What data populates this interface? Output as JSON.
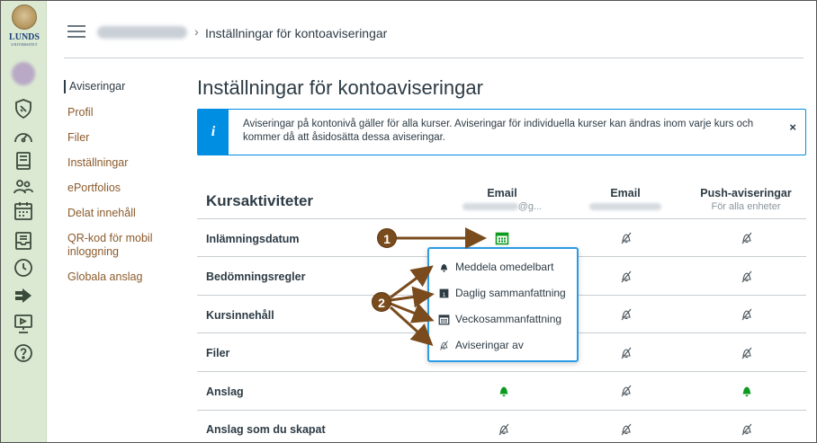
{
  "logo": {
    "name": "LUNDS",
    "subname": "UNIVERSITET"
  },
  "breadcrumb": {
    "separator": "›",
    "current": "Inställningar för kontoaviseringar"
  },
  "course_nav": {
    "items": [
      {
        "label": "Aviseringar",
        "active": true
      },
      {
        "label": "Profil",
        "active": false
      },
      {
        "label": "Filer",
        "active": false
      },
      {
        "label": "Inställningar",
        "active": false
      },
      {
        "label": "ePortfolios",
        "active": false
      },
      {
        "label": "Delat innehåll",
        "active": false
      },
      {
        "label": "QR-kod för mobil inloggning",
        "active": false
      },
      {
        "label": "Globala anslag",
        "active": false
      }
    ]
  },
  "page": {
    "title": "Inställningar för kontoaviseringar",
    "alert": {
      "icon": "info-icon",
      "icon_glyph": "i",
      "text": "Aviseringar på kontonivå gäller för alla kurser. Aviseringar för individuella kurser kan ändras inom varje kurs och kommer då att åsidosätta dessa aviseringar.",
      "close": "×"
    }
  },
  "table": {
    "heading": "Kursaktiviteter",
    "columns": [
      {
        "title": "Email",
        "subtitle_suffix": "@g..."
      },
      {
        "title": "Email",
        "subtitle_suffix": ""
      },
      {
        "title": "Push-aviseringar",
        "subtitle": "För alla enheter"
      }
    ],
    "rows": [
      {
        "label": "Inlämningsdatum",
        "cells": [
          "weekly-calendar-icon",
          "bell-off-icon",
          "bell-off-icon"
        ]
      },
      {
        "label": "Bedömningsregler",
        "cells": [
          "",
          "bell-off-icon",
          "bell-off-icon"
        ]
      },
      {
        "label": "Kursinnehåll",
        "cells": [
          "",
          "bell-off-icon",
          "bell-off-icon"
        ]
      },
      {
        "label": "Filer",
        "cells": [
          "",
          "bell-off-icon",
          "bell-off-icon"
        ]
      },
      {
        "label": "Anslag",
        "cells": [
          "bell-icon",
          "bell-off-icon",
          "bell-icon"
        ]
      },
      {
        "label": "Anslag som du skapat",
        "cells": [
          "bell-off-icon",
          "bell-off-icon",
          "bell-off-icon"
        ]
      }
    ]
  },
  "dropdown": {
    "items": [
      {
        "label": "Meddela omedelbart",
        "icon": "bell-icon"
      },
      {
        "label": "Daglig sammanfattning",
        "icon": "daily-calendar-icon"
      },
      {
        "label": "Veckosammanfattning",
        "icon": "weekly-calendar-icon"
      },
      {
        "label": "Aviseringar av",
        "icon": "bell-off-icon"
      }
    ]
  },
  "callouts": {
    "one": "1",
    "two": "2"
  },
  "colors": {
    "accent": "#008ee2",
    "active_green": "#0b9b1e",
    "link_brown": "#8b5a2b",
    "callout_brown": "#7a4b1c",
    "nav_bg": "#dbe9d3"
  }
}
